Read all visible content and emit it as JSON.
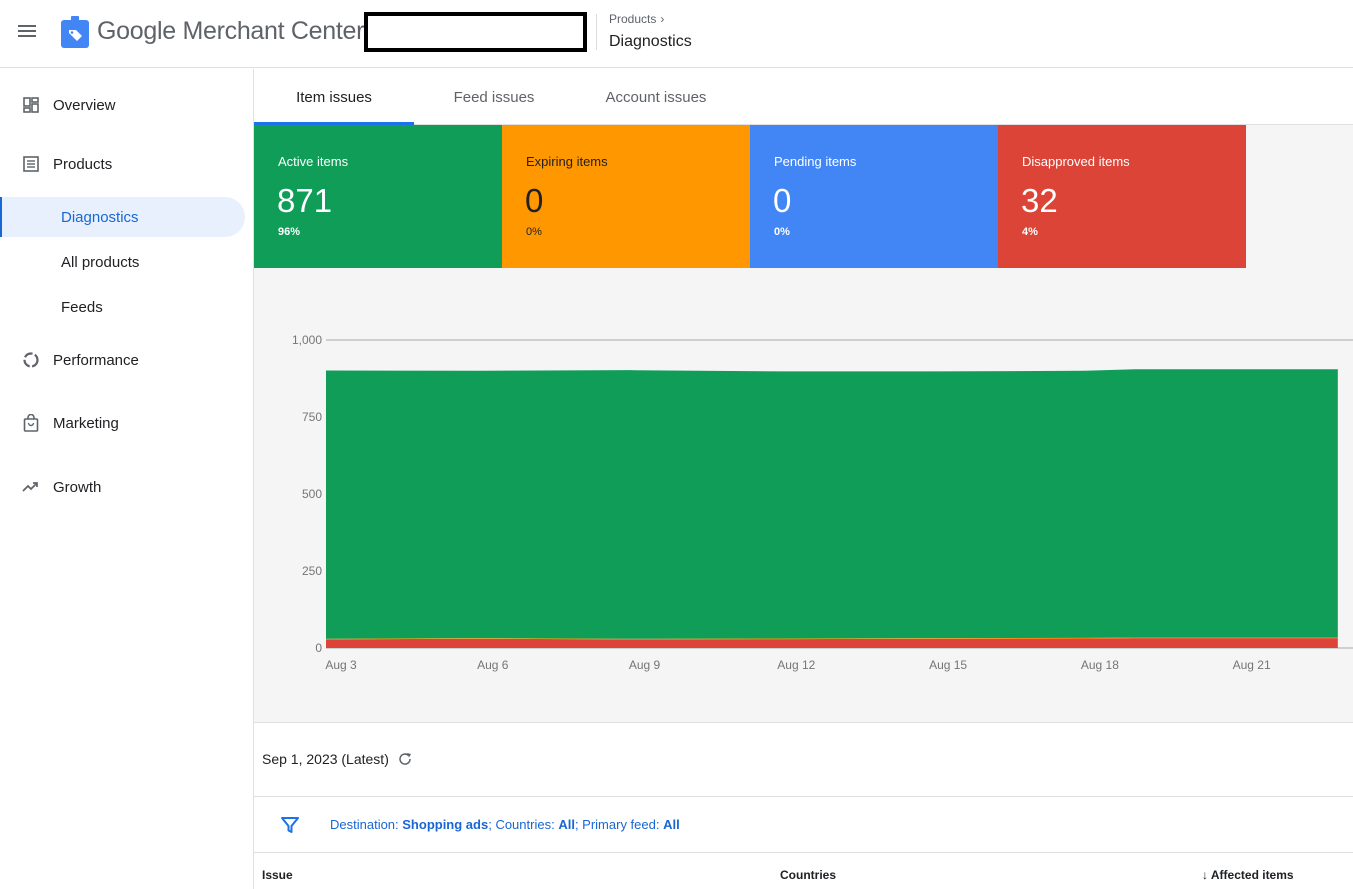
{
  "header": {
    "app_name": "Google Merchant Center",
    "breadcrumb_parent": "Products",
    "breadcrumb_current": "Diagnostics"
  },
  "sidebar": {
    "items": [
      {
        "label": "Overview",
        "icon": "dashboard-icon"
      },
      {
        "label": "Products",
        "icon": "list-icon"
      },
      {
        "label": "Diagnostics",
        "sub": true,
        "active": true
      },
      {
        "label": "All products",
        "sub": true
      },
      {
        "label": "Feeds",
        "sub": true
      },
      {
        "label": "Performance",
        "icon": "donut-chart-icon"
      },
      {
        "label": "Marketing",
        "icon": "shopping-bag-icon"
      },
      {
        "label": "Growth",
        "icon": "trending-up-icon"
      }
    ]
  },
  "tabs": [
    {
      "label": "Item issues",
      "active": true
    },
    {
      "label": "Feed issues"
    },
    {
      "label": "Account issues"
    }
  ],
  "cards": [
    {
      "title": "Active items",
      "value": "871",
      "percent": "96%",
      "color": "#0f9d58"
    },
    {
      "title": "Expiring items",
      "value": "0",
      "percent": "0%",
      "color": "#ff9800"
    },
    {
      "title": "Pending items",
      "value": "0",
      "percent": "0%",
      "color": "#4285f4"
    },
    {
      "title": "Disapproved items",
      "value": "32",
      "percent": "4%",
      "color": "#db4437"
    }
  ],
  "chart_data": {
    "type": "area",
    "stacked": true,
    "title": "",
    "xlabel": "",
    "ylabel": "",
    "ylim": [
      0,
      1000
    ],
    "yticks": [
      "0",
      "250",
      "500",
      "750",
      "1,000"
    ],
    "xticks": [
      "Aug 3",
      "Aug 6",
      "Aug 9",
      "Aug 12",
      "Aug 15",
      "Aug 18",
      "Aug 21"
    ],
    "x": [
      3,
      6,
      9,
      12,
      15,
      18,
      19,
      21,
      23
    ],
    "series": [
      {
        "values": [
          28,
          30,
          28,
          29,
          30,
          31,
          32,
          32,
          32
        ],
        "color": "#db4437"
      },
      {
        "values": [
          2,
          2,
          2,
          2,
          2,
          2,
          2,
          2,
          2
        ],
        "color": "#ff9800"
      },
      {
        "values": [
          871,
          868,
          872,
          867,
          866,
          867,
          871,
          871,
          871
        ],
        "color": "#0f9d58"
      }
    ],
    "grid": true
  },
  "status": {
    "date": "Sep 1, 2023 (Latest)"
  },
  "filter": {
    "dest_label": "Destination: ",
    "dest_value": "Shopping ads",
    "countries_label": "; Countries: ",
    "countries_value": "All",
    "feed_label": "; Primary feed: ",
    "feed_value": "All"
  },
  "table": {
    "col_issue": "Issue",
    "col_countries": "Countries",
    "col_affected": "Affected items"
  }
}
